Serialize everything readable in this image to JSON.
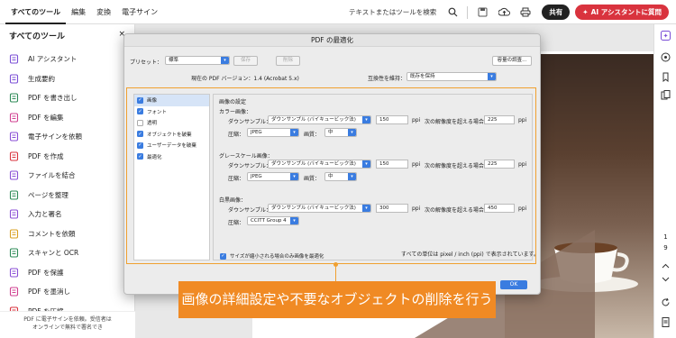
{
  "topbar": {
    "tabs": [
      "すべてのツール",
      "編集",
      "変換",
      "電子サイン"
    ],
    "search_text": "テキストまたはツールを検索",
    "share_label": "共有",
    "ai_label": "AI アシスタントに質問",
    "colors": {
      "ai_button": "#d9333e",
      "share_button": "#222222"
    }
  },
  "leftpanel": {
    "title": "すべてのツール",
    "close": "×",
    "tools": [
      {
        "label": "AI アシスタント",
        "icon": "ai-assistant-icon",
        "color": "#7b4fd6"
      },
      {
        "label": "生成要約",
        "icon": "summary-icon",
        "color": "#7b4fd6"
      },
      {
        "label": "PDF を書き出し",
        "icon": "export-pdf-icon",
        "color": "#2e8b57"
      },
      {
        "label": "PDF を編集",
        "icon": "edit-pdf-icon",
        "color": "#d04090"
      },
      {
        "label": "電子サインを依頼",
        "icon": "request-esign-icon",
        "color": "#8a4fd6"
      },
      {
        "label": "PDF を作成",
        "icon": "create-pdf-icon",
        "color": "#d9333e"
      },
      {
        "label": "ファイルを結合",
        "icon": "combine-files-icon",
        "color": "#8a4fd6"
      },
      {
        "label": "ページを整理",
        "icon": "organize-pages-icon",
        "color": "#2e8b57"
      },
      {
        "label": "入力と署名",
        "icon": "fill-sign-icon",
        "color": "#8a4fd6"
      },
      {
        "label": "コメントを依頼",
        "icon": "request-comments-icon",
        "color": "#d9a020"
      },
      {
        "label": "スキャンと OCR",
        "icon": "scan-ocr-icon",
        "color": "#2e8b57"
      },
      {
        "label": "PDF を保護",
        "icon": "protect-pdf-icon",
        "color": "#8a4fd6"
      },
      {
        "label": "PDF を墨消し",
        "icon": "redact-pdf-icon",
        "color": "#d04090"
      },
      {
        "label": "PDF を圧縮",
        "icon": "compress-pdf-icon",
        "color": "#d9333e"
      }
    ],
    "footer_line1": "PDF に電子サインを依頼。受信者は",
    "footer_line2": "オンラインで無料で署名でき"
  },
  "dialog": {
    "title": "PDF の最適化",
    "preset_label": "プリセット：",
    "preset_value": "標準",
    "save_label": "保存",
    "delete_label": "削除",
    "audit_label": "容量の調査...",
    "version_text": "現在の PDF バージョン：1.4 (Acrobat 5.x)",
    "compat_label": "互換性を維持：",
    "compat_value": "既存を保持",
    "nav_items": [
      {
        "label": "画像",
        "checked": true,
        "selected": true
      },
      {
        "label": "フォント",
        "checked": true,
        "selected": false
      },
      {
        "label": "透明",
        "checked": false,
        "selected": false
      },
      {
        "label": "オブジェクトを破棄",
        "checked": true,
        "selected": false
      },
      {
        "label": "ユーザーデータを破棄",
        "checked": true,
        "selected": false
      },
      {
        "label": "最適化",
        "checked": true,
        "selected": false
      }
    ],
    "panel_title": "画像の設定",
    "sections": [
      {
        "heading": "カラー画像：",
        "downsample_label": "ダウンサンプル：",
        "downsample_value": "ダウンサンプル (バイキュービック法)",
        "ppi_value": "150",
        "ppi_unit": "ppi",
        "above_label": "次の解像度を超える場合：",
        "above_value": "225",
        "above_unit": "ppi",
        "compress_label": "圧縮：",
        "compress_value": "JPEG",
        "quality_label": "画質：",
        "quality_value": "中"
      },
      {
        "heading": "グレースケール画像：",
        "downsample_label": "ダウンサンプル：",
        "downsample_value": "ダウンサンプル (バイキュービック法)",
        "ppi_value": "150",
        "ppi_unit": "ppi",
        "above_label": "次の解像度を超える場合：",
        "above_value": "225",
        "above_unit": "ppi",
        "compress_label": "圧縮：",
        "compress_value": "JPEG",
        "quality_label": "画質：",
        "quality_value": "中"
      },
      {
        "heading": "白黒画像：",
        "downsample_label": "ダウンサンプル：",
        "downsample_value": "ダウンサンプル (バイキュービック法)",
        "ppi_value": "300",
        "ppi_unit": "ppi",
        "above_label": "次の解像度を超える場合：",
        "above_value": "450",
        "above_unit": "ppi",
        "compress_label": "圧縮：",
        "compress_value": "CCITT Group 4"
      }
    ],
    "units_note": "すべての単位は pixel / inch (ppi) で表示されています。",
    "bottom_checkbox_label": "サイズが縮小される場合のみ画像を最適化",
    "ok_label": "OK"
  },
  "caption": {
    "text": "画像の詳細設定や不要なオブジェクトの削除を行う",
    "color": "#f08a24"
  },
  "rightbar": {
    "page_current": "1",
    "page_total": "9"
  }
}
